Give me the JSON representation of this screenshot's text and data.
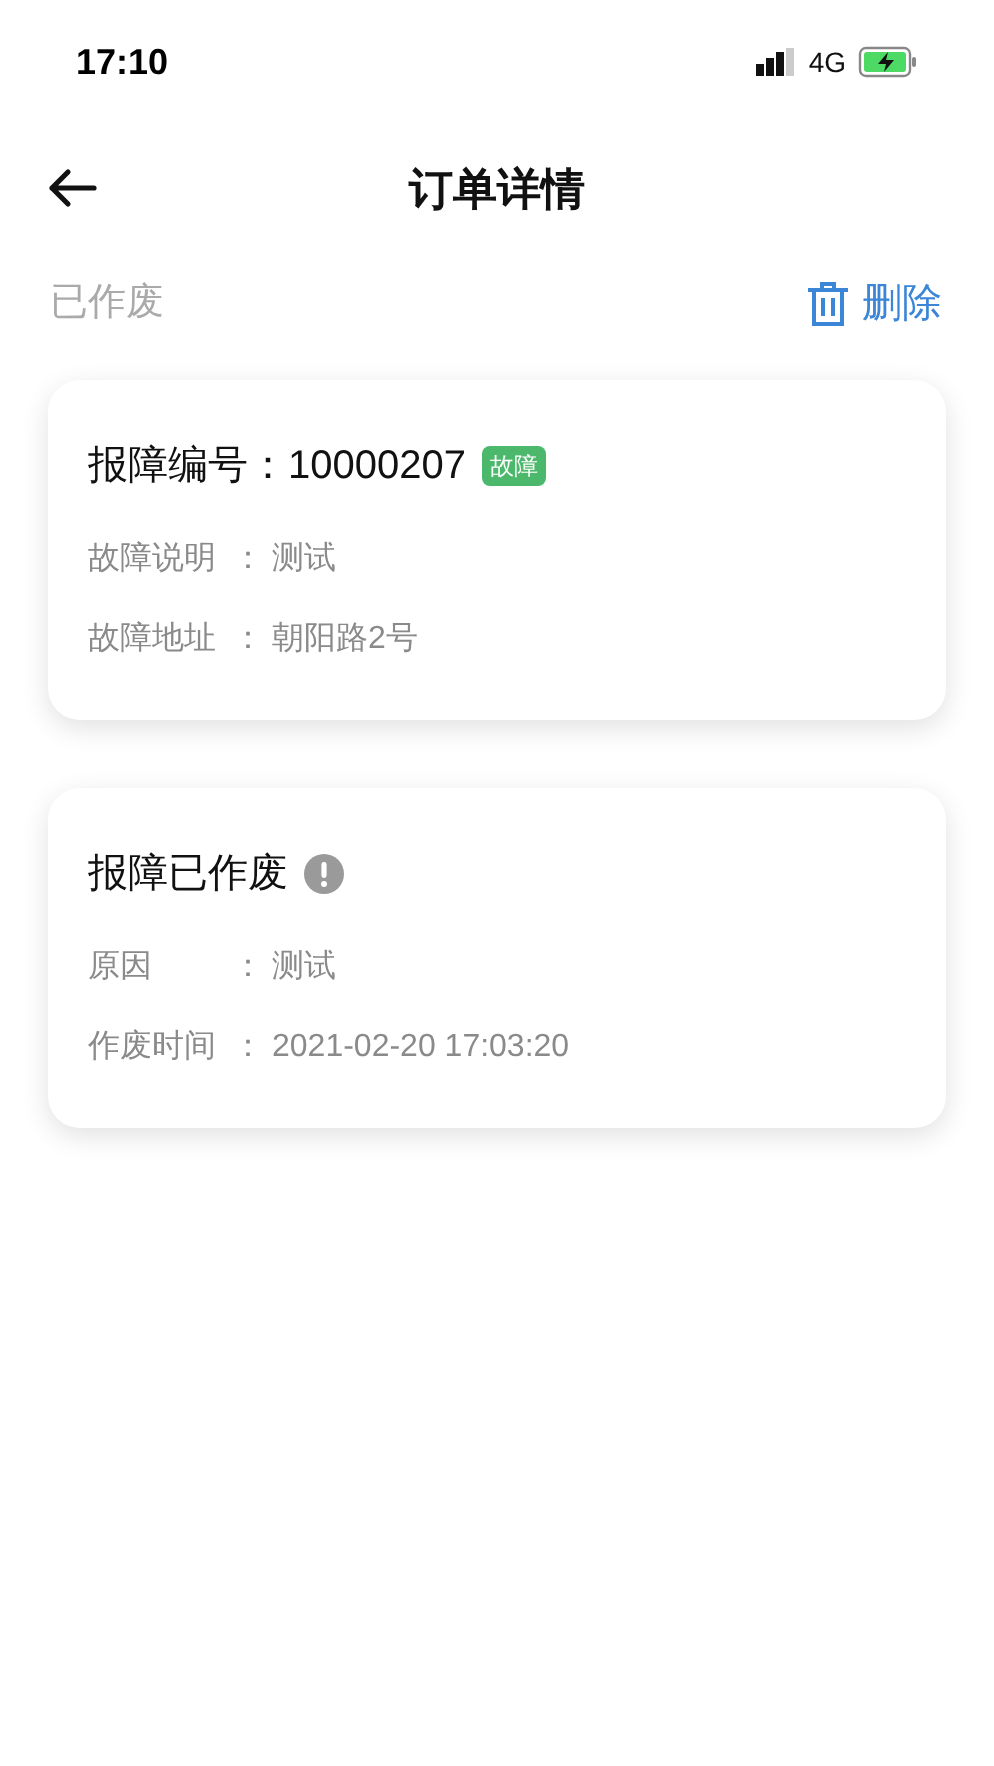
{
  "status_bar": {
    "time": "17:10",
    "network": "4G"
  },
  "header": {
    "title": "订单详情"
  },
  "order_status": "已作废",
  "delete_action": {
    "label": "删除"
  },
  "cards": [
    {
      "kind": "report",
      "title": "报障编号：10000207",
      "tag": {
        "label": "故障",
        "color": "#4cb86b"
      },
      "fields": [
        {
          "label": "故障说明",
          "separator": "：",
          "value": "测试"
        },
        {
          "label": "故障地址",
          "separator": "：",
          "value": "朝阳路2号"
        }
      ]
    },
    {
      "kind": "voided",
      "title": "报障已作废",
      "fields": [
        {
          "label": "原因",
          "separator": "：",
          "value": "测试"
        },
        {
          "label": "作废时间",
          "separator": "：",
          "value": "2021-02-20 17:03:20"
        }
      ]
    }
  ]
}
